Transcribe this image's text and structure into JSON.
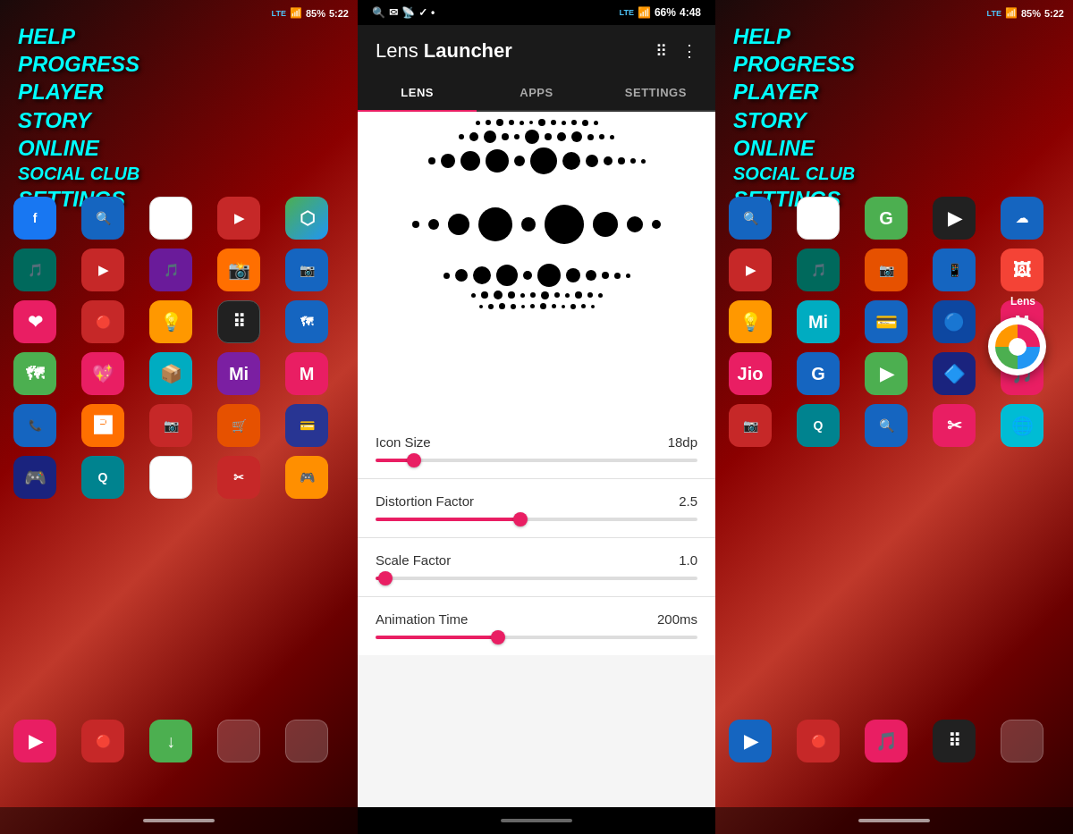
{
  "leftPanel": {
    "statusBar": {
      "signal": "LTE",
      "wifi": "▲▼",
      "battery": "85%",
      "time": "5:22"
    },
    "decorText": [
      "HELP",
      "PROGRESS",
      "PLAYER",
      "STORY",
      "ONLINE",
      "SOCIAL CLUB",
      "SETTINGS"
    ]
  },
  "centerPanel": {
    "statusBar": {
      "icons": "🔍 ✉ 📡 ✓ •",
      "signal": "LTE",
      "battery": "66%",
      "time": "4:48"
    },
    "header": {
      "titleNormal": "Lens",
      "titleBold": " Launcher",
      "gridIcon": "⠿",
      "menuIcon": "⋮"
    },
    "tabs": [
      {
        "label": "LENS",
        "active": true
      },
      {
        "label": "APPS",
        "active": false
      },
      {
        "label": "SETTINGS",
        "active": false
      }
    ],
    "sliders": [
      {
        "name": "Icon Size",
        "value": "18dp",
        "fillPercent": 12,
        "thumbPercent": 12
      },
      {
        "name": "Distortion Factor",
        "value": "2.5",
        "fillPercent": 45,
        "thumbPercent": 45
      },
      {
        "name": "Scale Factor",
        "value": "1.0",
        "fillPercent": 3,
        "thumbPercent": 3
      },
      {
        "name": "Animation Time",
        "value": "200ms",
        "fillPercent": 38,
        "thumbPercent": 38
      }
    ]
  },
  "rightPanel": {
    "statusBar": {
      "signal": "LTE",
      "wifi": "▲▼",
      "battery": "85%",
      "time": "5:22"
    },
    "decorText": [
      "HELP",
      "PROGRESS",
      "PLAYER",
      "STORY",
      "ONLINE",
      "SOCIAL CLUB",
      "SETTINGS"
    ],
    "lensLabel": "Lens"
  }
}
